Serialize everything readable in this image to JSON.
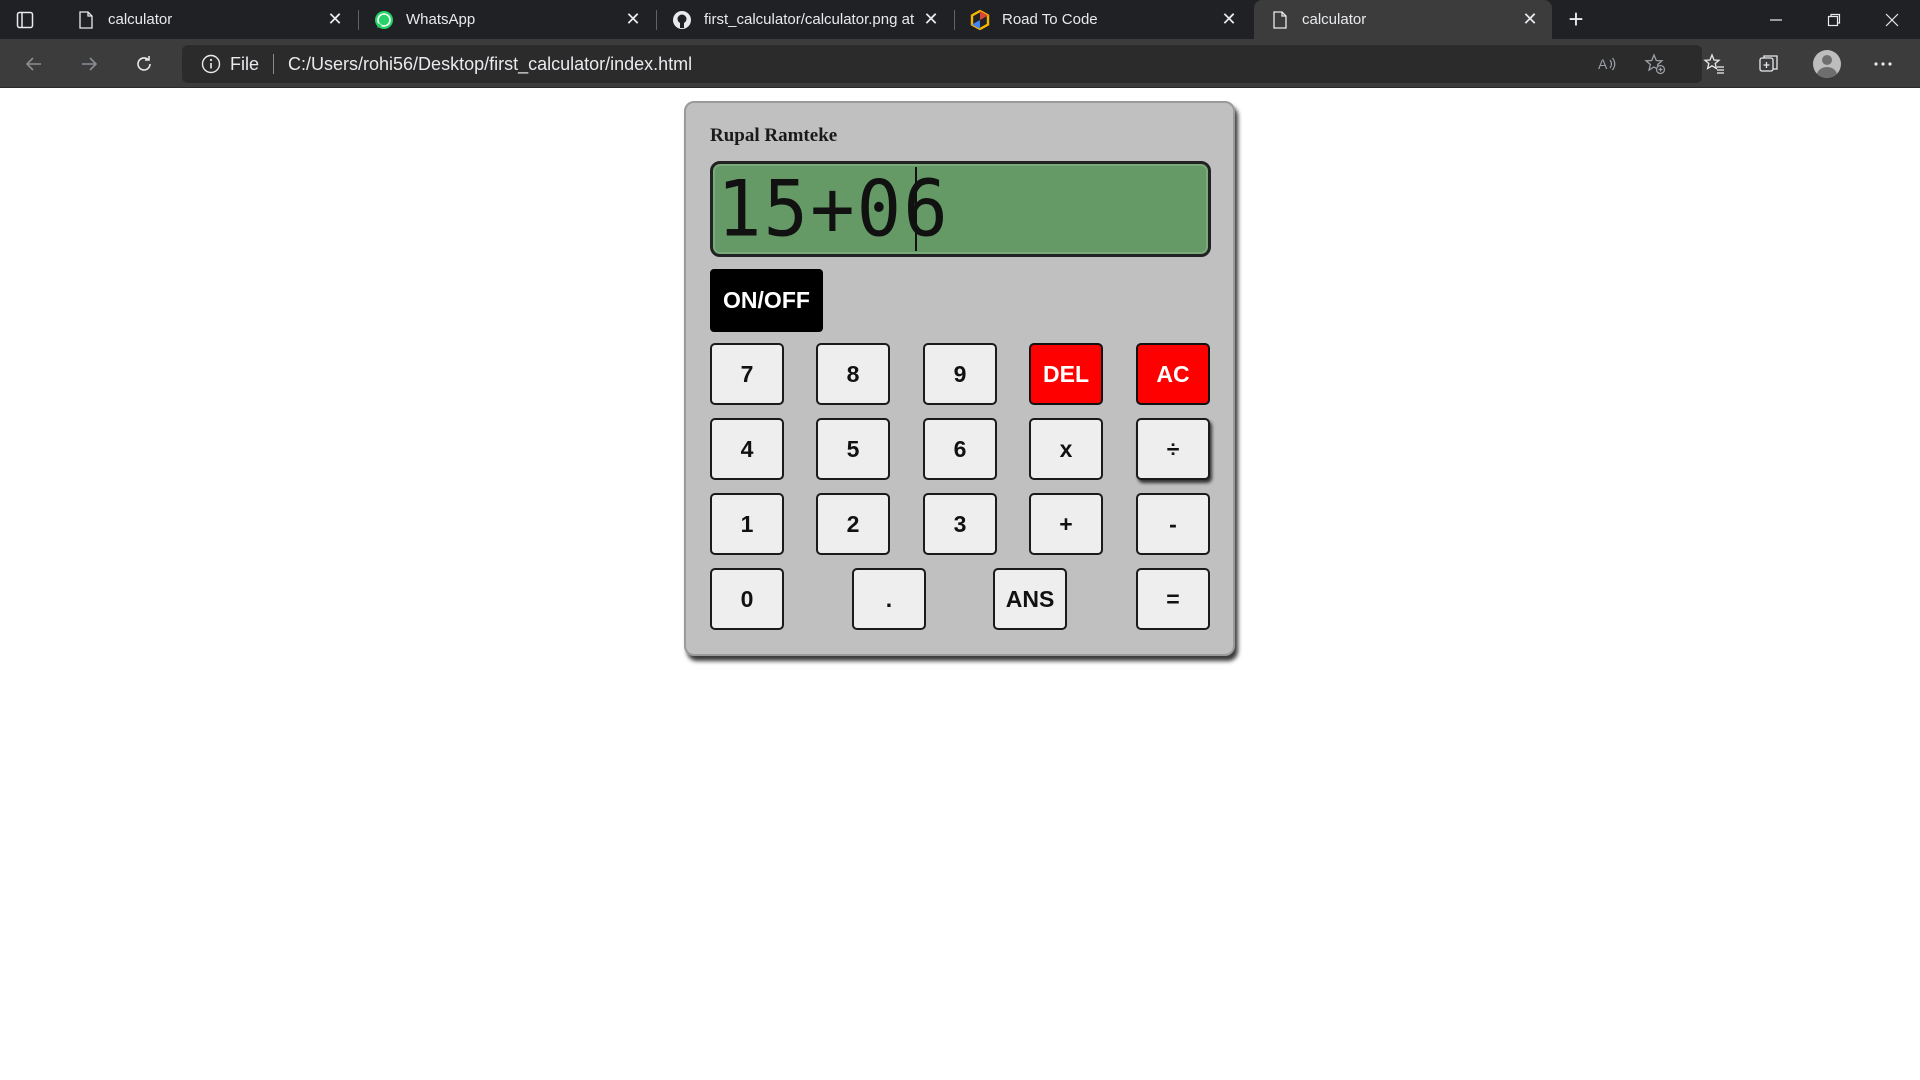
{
  "browser": {
    "tabs": [
      {
        "title": "calculator",
        "icon": "page-icon"
      },
      {
        "title": "WhatsApp",
        "icon": "whatsapp-icon"
      },
      {
        "title": "first_calculator/calculator.png at",
        "icon": "github-icon"
      },
      {
        "title": "Road To Code",
        "icon": "road-to-code-icon"
      },
      {
        "title": "calculator",
        "icon": "page-icon",
        "active": true
      }
    ],
    "address": {
      "scheme_label": "File",
      "url": "C:/Users/rohi56/Desktop/first_calculator/index.html"
    }
  },
  "calculator": {
    "owner_name": "Rupal Ramteke",
    "display_value": "15+06",
    "power_label": "ON/OFF",
    "rows": [
      [
        {
          "label": "7"
        },
        {
          "label": "8"
        },
        {
          "label": "9"
        },
        {
          "label": "DEL",
          "style": "red"
        },
        {
          "label": "AC",
          "style": "red"
        }
      ],
      [
        {
          "label": "4"
        },
        {
          "label": "5"
        },
        {
          "label": "6"
        },
        {
          "label": "x"
        },
        {
          "label": "÷"
        }
      ],
      [
        {
          "label": "1"
        },
        {
          "label": "2"
        },
        {
          "label": "3"
        },
        {
          "label": "+"
        },
        {
          "label": "-"
        }
      ],
      [
        {
          "label": "0"
        },
        {
          "label": "."
        },
        {
          "label": "ANS"
        },
        {
          "label": "="
        }
      ]
    ],
    "colors": {
      "body": "#c0c0c0",
      "display": "#659966",
      "key_red": "#ff0000",
      "power": "#000000"
    }
  }
}
